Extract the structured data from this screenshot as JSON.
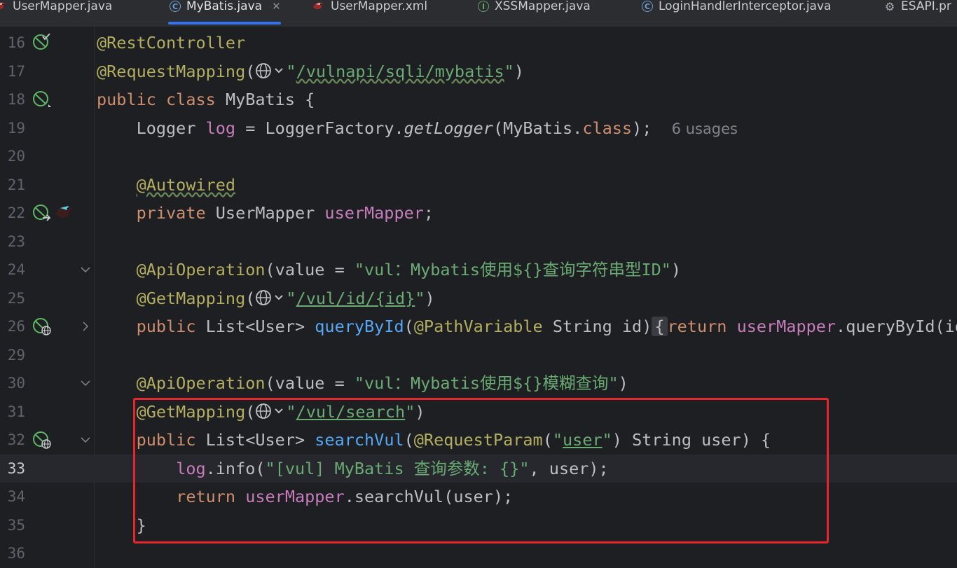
{
  "tabs": [
    {
      "label": "UserMapper.java",
      "icon": "mybatis-bird-icon"
    },
    {
      "label": "MyBatis.java",
      "icon": "class-icon",
      "active": true
    },
    {
      "label": "UserMapper.xml",
      "icon": "mybatis-bird-icon"
    },
    {
      "label": "XSSMapper.java",
      "icon": "interface-icon"
    },
    {
      "label": "LoginHandlerInterceptor.java",
      "icon": "class-icon"
    },
    {
      "label": "ESAPI.pr",
      "icon": "gear-icon"
    }
  ],
  "tab_glyphs": {
    "class": "C",
    "interface": "I",
    "gear": "⚙",
    "close": "✕"
  },
  "editor": {
    "line_numbers": [
      "16",
      "17",
      "18",
      "19",
      "20",
      "21",
      "22",
      "23",
      "24",
      "25",
      "26",
      "29",
      "30",
      "31",
      "32",
      "33",
      "34",
      "35",
      "36"
    ],
    "current_line": "33",
    "lines": [
      {
        "n": "16",
        "t": [
          {
            "c": "ann",
            "v": "@RestController"
          }
        ]
      },
      {
        "n": "17",
        "t": [
          {
            "c": "ann",
            "v": "@RequestMapping"
          },
          {
            "v": "("
          },
          {
            "globe": true
          },
          {
            "c": "str",
            "v": "\""
          },
          {
            "c": "str und wavy",
            "v": "/vulnapi/sqli/mybatis"
          },
          {
            "c": "str",
            "v": "\""
          },
          {
            "v": ")"
          }
        ]
      },
      {
        "n": "18",
        "t": [
          {
            "c": "kw",
            "v": "public class "
          },
          {
            "v": "MyBatis {"
          }
        ]
      },
      {
        "n": "19",
        "t": [
          {
            "v": "    Logger "
          },
          {
            "c": "fld",
            "v": "log"
          },
          {
            "v": " = LoggerFactory."
          },
          {
            "c": "it",
            "v": "getLogger"
          },
          {
            "v": "(MyBatis."
          },
          {
            "c": "kw",
            "v": "class"
          },
          {
            "v": ");  "
          },
          {
            "c": "hint",
            "v": "6 usages"
          }
        ]
      },
      {
        "n": "20",
        "t": []
      },
      {
        "n": "21",
        "t": [
          {
            "v": "    "
          },
          {
            "c": "ann wavy",
            "v": "@Autowired"
          }
        ]
      },
      {
        "n": "22",
        "t": [
          {
            "v": "    "
          },
          {
            "c": "kw",
            "v": "private "
          },
          {
            "v": "UserMapper "
          },
          {
            "c": "fld",
            "v": "userMapper"
          },
          {
            "v": ";"
          }
        ]
      },
      {
        "n": "23",
        "t": []
      },
      {
        "n": "24",
        "t": [
          {
            "v": "    "
          },
          {
            "c": "ann",
            "v": "@ApiOperation"
          },
          {
            "v": "(value = "
          },
          {
            "c": "str",
            "v": "\"vul：Mybatis使用${}查询字符串型ID\""
          },
          {
            "v": ")"
          }
        ]
      },
      {
        "n": "25",
        "t": [
          {
            "v": "    "
          },
          {
            "c": "ann",
            "v": "@GetMapping"
          },
          {
            "v": "("
          },
          {
            "globe": true
          },
          {
            "c": "str",
            "v": "\""
          },
          {
            "c": "str und",
            "v": "/vul/id/{id}"
          },
          {
            "c": "str",
            "v": "\""
          },
          {
            "v": ")"
          }
        ]
      },
      {
        "n": "26",
        "t": [
          {
            "v": "    "
          },
          {
            "c": "kw",
            "v": "public "
          },
          {
            "v": "List<User> "
          },
          {
            "c": "mth",
            "v": "queryById"
          },
          {
            "v": "("
          },
          {
            "c": "ann",
            "v": "@PathVariable"
          },
          {
            "v": " String id)"
          },
          {
            "c": "foldbox",
            "v": "{"
          },
          {
            "c": "kw",
            "v": "return "
          },
          {
            "c": "fld",
            "v": "userMapper"
          },
          {
            "v": ".queryById(id); }"
          }
        ]
      },
      {
        "n": "29",
        "t": []
      },
      {
        "n": "30",
        "t": [
          {
            "v": "    "
          },
          {
            "c": "ann",
            "v": "@ApiOperation"
          },
          {
            "v": "(value = "
          },
          {
            "c": "str",
            "v": "\"vul：Mybatis使用${}模糊查询\""
          },
          {
            "v": ")"
          }
        ]
      },
      {
        "n": "31",
        "t": [
          {
            "v": "    "
          },
          {
            "c": "ann",
            "v": "@GetMapping"
          },
          {
            "v": "("
          },
          {
            "globe": true
          },
          {
            "c": "str",
            "v": "\""
          },
          {
            "c": "str und",
            "v": "/vul/search"
          },
          {
            "c": "str",
            "v": "\""
          },
          {
            "v": ")"
          }
        ]
      },
      {
        "n": "32",
        "t": [
          {
            "v": "    "
          },
          {
            "c": "kw",
            "v": "public "
          },
          {
            "v": "List<User> "
          },
          {
            "c": "mth",
            "v": "searchVul"
          },
          {
            "v": "("
          },
          {
            "c": "ann",
            "v": "@RequestParam"
          },
          {
            "v": "("
          },
          {
            "c": "str",
            "v": "\""
          },
          {
            "c": "str und",
            "v": "user"
          },
          {
            "c": "str",
            "v": "\""
          },
          {
            "v": ") String user) {"
          }
        ]
      },
      {
        "n": "33",
        "t": [
          {
            "v": "        "
          },
          {
            "c": "fld",
            "v": "log"
          },
          {
            "v": ".info("
          },
          {
            "c": "str",
            "v": "\"[vul] MyBatis 查询参数: {}\""
          },
          {
            "v": ", user);"
          }
        ]
      },
      {
        "n": "34",
        "t": [
          {
            "v": "        "
          },
          {
            "c": "kw",
            "v": "return "
          },
          {
            "c": "fld",
            "v": "userMapper"
          },
          {
            "v": ".searchVul(user);"
          }
        ]
      },
      {
        "n": "35",
        "t": [
          {
            "v": "    }"
          }
        ]
      },
      {
        "n": "36",
        "t": []
      }
    ],
    "gutter_icons": [
      {
        "line": "16",
        "icon": "spring-bean-check-icon"
      },
      {
        "line": "18",
        "icon": "spring-bean-icon"
      },
      {
        "line": "22",
        "icon": "spring-bean-navigate-icon"
      },
      {
        "line": "22",
        "icon": "mybatis-bird-icon"
      },
      {
        "line": "26",
        "icon": "spring-web-endpoint-icon"
      },
      {
        "line": "32",
        "icon": "spring-web-endpoint-icon"
      }
    ],
    "fold_markers": [
      {
        "line": "24",
        "icon": "fold-open-chevron-icon"
      },
      {
        "line": "26",
        "icon": "fold-closed-chevron-icon"
      },
      {
        "line": "30",
        "icon": "fold-open-chevron-icon"
      },
      {
        "line": "32",
        "icon": "fold-open-chevron-icon"
      }
    ]
  },
  "colors": {
    "background": "#1e1f22",
    "annotation": "#b3ae60",
    "keyword": "#cf8e6d",
    "string": "#6aab73",
    "field": "#c77dbb",
    "method": "#56a8f5",
    "highlight_box": "#e5262d",
    "active_tab_underline": "#3574f0"
  }
}
